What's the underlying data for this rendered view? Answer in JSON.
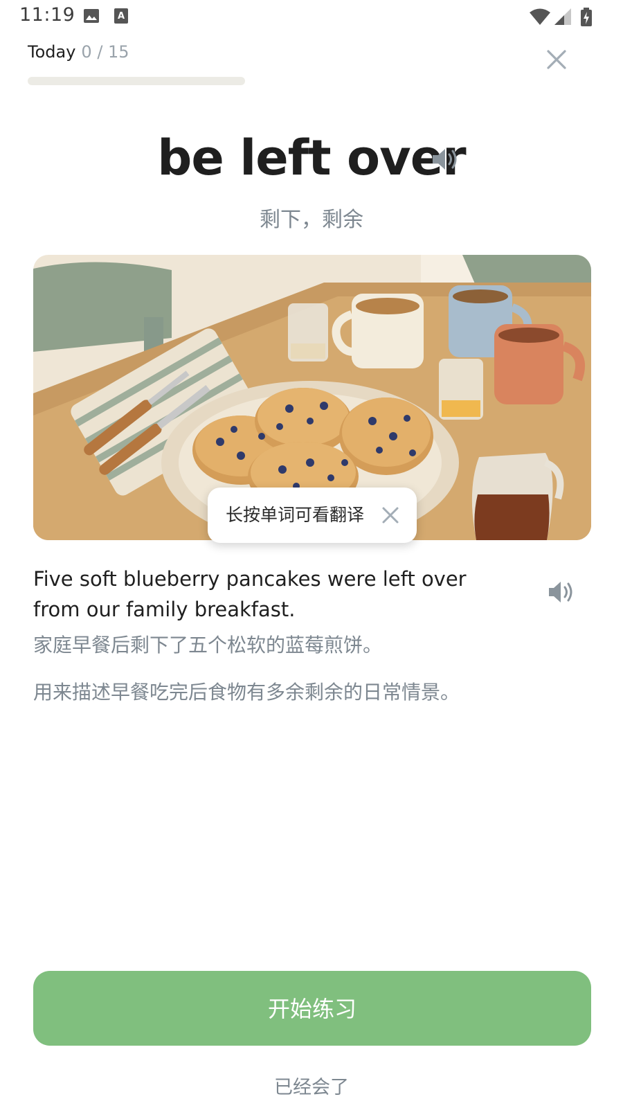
{
  "status_bar": {
    "time": "11:19",
    "icons": [
      "image-icon",
      "font-icon",
      "wifi-icon",
      "signal-icon",
      "battery-icon"
    ]
  },
  "header": {
    "today_label": "Today",
    "today_count": "0 / 15",
    "progress": 0,
    "close_icon": "close-icon"
  },
  "word": {
    "text": "be left over",
    "meaning": "剩下，剩余",
    "audio_icon": "speaker-icon"
  },
  "illustration": {
    "description_icon": "pancake-breakfast-illustration",
    "hint": {
      "text": "长按单词可看翻译",
      "close_icon": "close-icon"
    }
  },
  "sentence": {
    "english": "Five soft blueberry pancakes were left over from our family breakfast.",
    "chinese": "家庭早餐后剩下了五个松软的蓝莓煎饼。",
    "usage_note": "用来描述早餐吃完后食物有多余剩余的日常情景。",
    "audio_icon": "speaker-icon"
  },
  "footer": {
    "start_button": "开始练习",
    "known_link": "已经会了"
  },
  "colors": {
    "accent": "#80bf7e",
    "muted_text": "#7d8790",
    "progress_track": "#ecebe5"
  }
}
